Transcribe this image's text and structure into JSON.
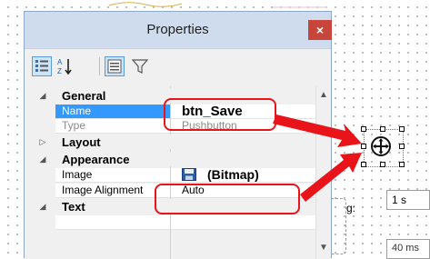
{
  "window": {
    "title": "Properties",
    "close_glyph": "×"
  },
  "toolbar": {
    "buttons": [
      {
        "icon": "categorized-icon",
        "active": true
      },
      {
        "icon": "sort-alphabetical-icon",
        "active": false
      },
      {
        "icon": "property-pages-icon",
        "active": true
      },
      {
        "icon": "filter-icon",
        "active": false
      }
    ]
  },
  "grid": {
    "categories": {
      "general": "General",
      "layout": "Layout",
      "appearance": "Appearance",
      "text": "Text"
    },
    "properties": {
      "name": {
        "label": "Name",
        "value": "btn_Save"
      },
      "type": {
        "label": "Type",
        "value": "Pushbutton"
      },
      "image": {
        "label": "Image",
        "value": "(Bitmap)"
      },
      "image_alignment": {
        "label": "Image Alignment",
        "value": "Auto"
      }
    }
  },
  "background": {
    "label_fragment": "g:",
    "time_value": "1 s",
    "time_value_2": "40 ms"
  },
  "colors": {
    "callout": "#e8141a",
    "selection": "#3399ff",
    "close_button": "#c8453c",
    "title_bar": "#cfdcee"
  }
}
